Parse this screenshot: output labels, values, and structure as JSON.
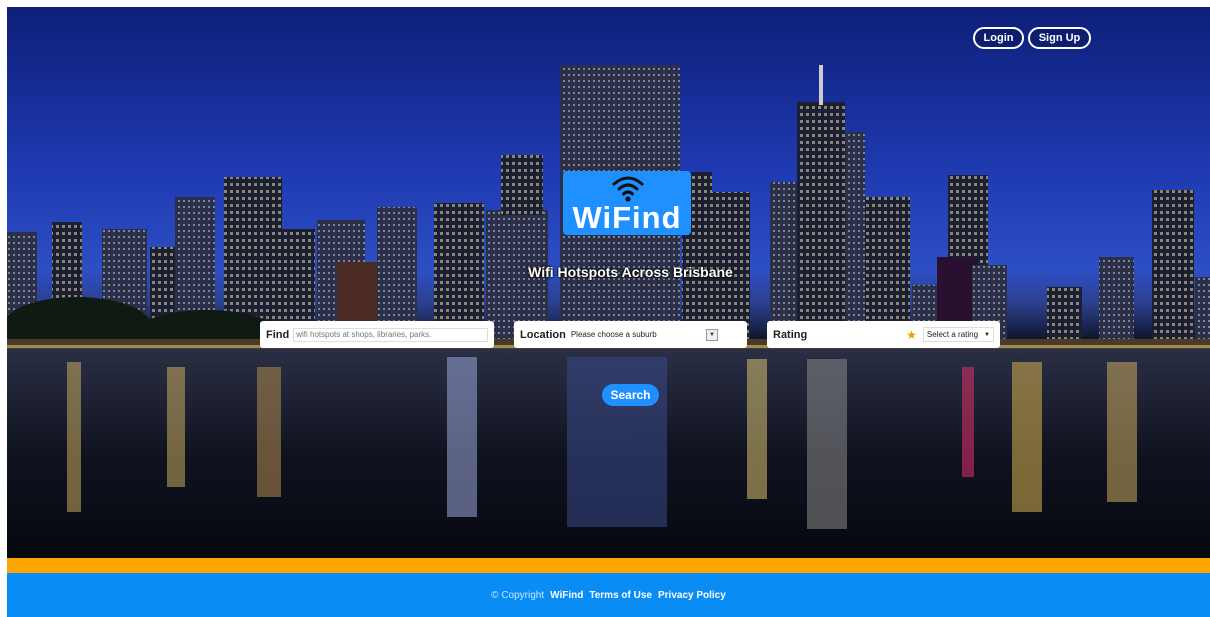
{
  "header": {
    "login_label": "Login",
    "signup_label": "Sign Up"
  },
  "brand": {
    "logo_text": "WiFind",
    "tagline": "Wifi Hotspots Across Brisbane",
    "accent_color": "#1e90ff",
    "stripe_color": "#ffa500"
  },
  "search": {
    "find_label": "Find",
    "find_placeholder": "wifi hotspots at shops, libraries, parks.",
    "location_label": "Location",
    "location_value": "Please choose a suburb",
    "rating_label": "Rating",
    "rating_value": "Select a rating",
    "search_label": "Search"
  },
  "footer": {
    "copyright_prefix": "© Copyright",
    "brand": "WiFind",
    "terms_label": "Terms of Use",
    "privacy_label": "Privacy Policy"
  }
}
